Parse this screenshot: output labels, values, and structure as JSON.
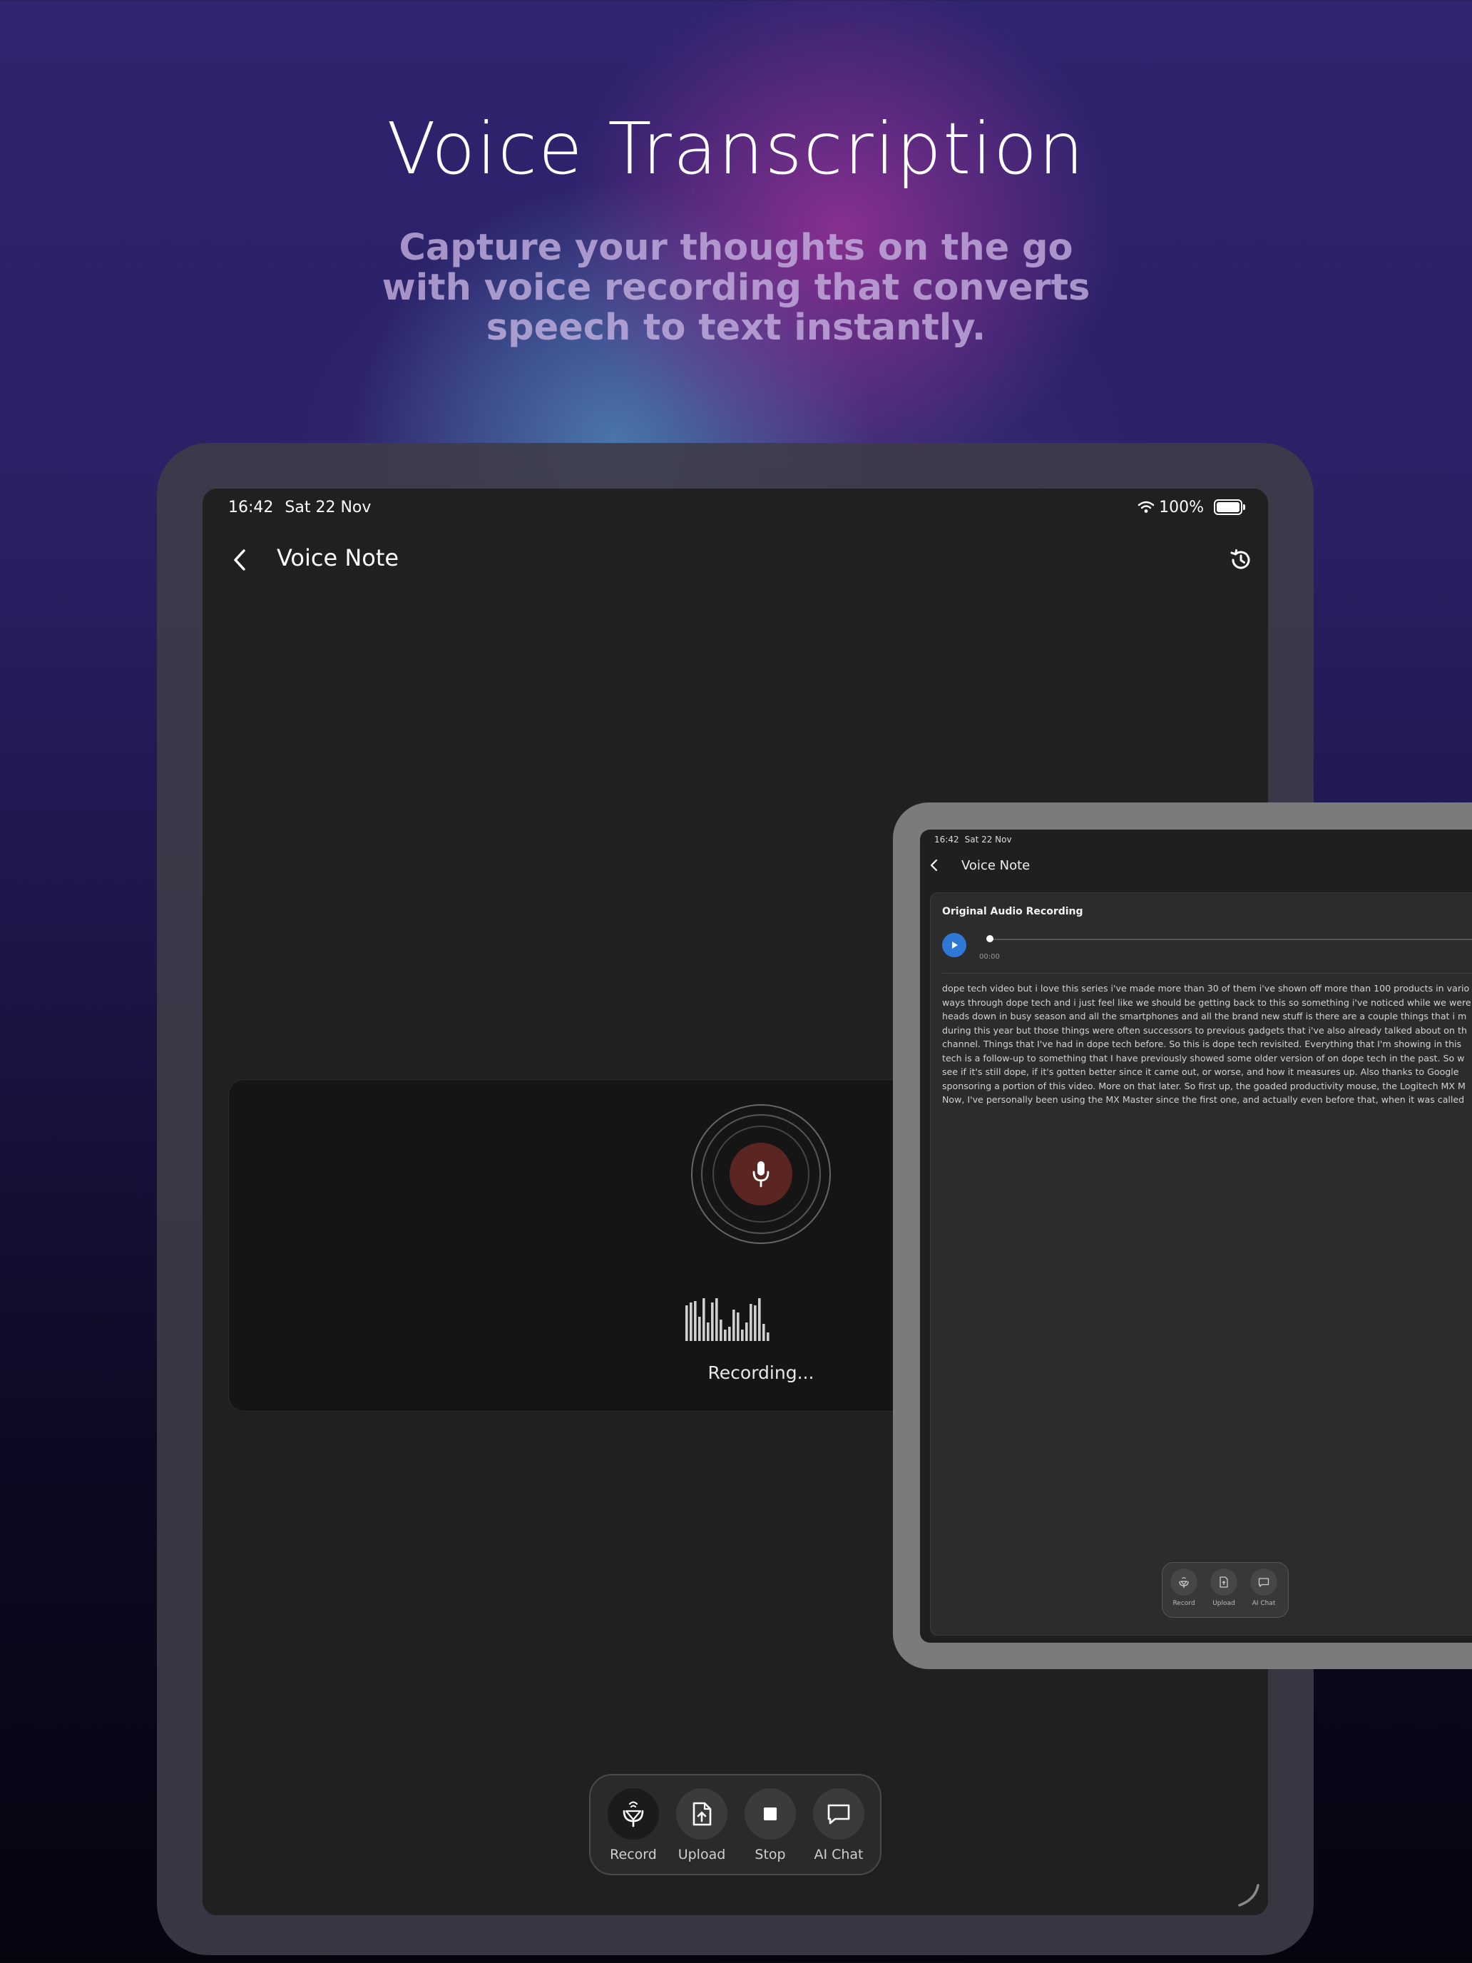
{
  "hero": {
    "title": "Voice Transcription",
    "subtitle_line1": "Capture your thoughts on the go",
    "subtitle_line2": "with voice recording that converts",
    "subtitle_line3": "speech to text instantly."
  },
  "main_device": {
    "status_bar": {
      "time": "16:42",
      "date": "Sat 22 Nov",
      "battery": "100%"
    },
    "nav": {
      "title": "Voice Note",
      "back_icon": "chevron-left-icon",
      "history_icon": "history-icon"
    },
    "recorder": {
      "status": "Recording...",
      "mic_icon": "microphone-icon",
      "mic_color": "#5b2622"
    },
    "toolbar": [
      {
        "label": "Record",
        "icon": "record-icon",
        "active": true
      },
      {
        "label": "Upload",
        "icon": "upload-file-icon"
      },
      {
        "label": "Stop",
        "icon": "stop-icon"
      },
      {
        "label": "AI Chat",
        "icon": "chat-icon"
      }
    ]
  },
  "inset_device": {
    "status_bar": {
      "time": "16:42",
      "date": "Sat 22 Nov"
    },
    "nav": {
      "title": "Voice Note"
    },
    "audio": {
      "title": "Original Audio Recording",
      "time": "00:00",
      "play_color": "#2f78d6"
    },
    "transcript_lines": [
      "dope tech video but i love this series i've made more than 30 of them i've shown off more than 100 products in vario",
      "ways through dope tech and i just feel like we should be getting back to this so something i've noticed while we were",
      "heads down in busy season and all the smartphones and all the brand new stuff is there are a couple things that i m",
      "during this year but those things were often successors to previous gadgets that i've also already talked about on th",
      "channel. Things that I've had in dope tech before. So this is dope tech revisited. Everything that I'm showing in this",
      "tech is a follow-up to something that I have previously showed some older version of on dope tech in the past. So w",
      "see if it's still dope, if it's gotten better since it came out, or worse, and how it measures up. Also thanks to Google",
      "sponsoring a portion of this video. More on that later. So first up, the goaded productivity mouse, the Logitech MX M",
      "Now, I've personally been using the MX Master since the first one, and actually even before that, when it was called"
    ],
    "toolbar": [
      {
        "label": "Record",
        "icon": "record-icon"
      },
      {
        "label": "Upload",
        "icon": "upload-file-icon"
      },
      {
        "label": "AI Chat",
        "icon": "chat-icon"
      }
    ]
  }
}
